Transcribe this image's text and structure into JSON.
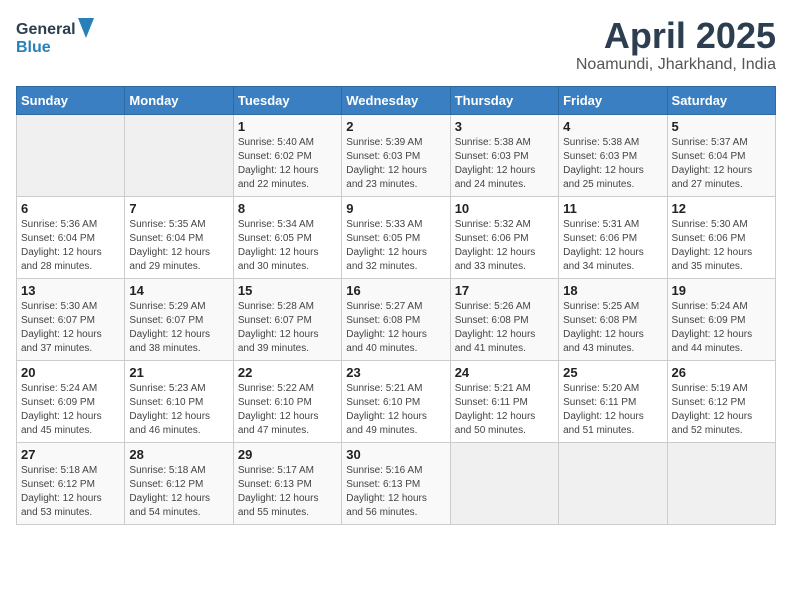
{
  "header": {
    "logo_line1": "General",
    "logo_line2": "Blue",
    "title": "April 2025",
    "subtitle": "Noamundi, Jharkhand, India"
  },
  "calendar": {
    "days_of_week": [
      "Sunday",
      "Monday",
      "Tuesday",
      "Wednesday",
      "Thursday",
      "Friday",
      "Saturday"
    ],
    "weeks": [
      [
        {
          "num": "",
          "detail": ""
        },
        {
          "num": "",
          "detail": ""
        },
        {
          "num": "1",
          "detail": "Sunrise: 5:40 AM\nSunset: 6:02 PM\nDaylight: 12 hours and 22 minutes."
        },
        {
          "num": "2",
          "detail": "Sunrise: 5:39 AM\nSunset: 6:03 PM\nDaylight: 12 hours and 23 minutes."
        },
        {
          "num": "3",
          "detail": "Sunrise: 5:38 AM\nSunset: 6:03 PM\nDaylight: 12 hours and 24 minutes."
        },
        {
          "num": "4",
          "detail": "Sunrise: 5:38 AM\nSunset: 6:03 PM\nDaylight: 12 hours and 25 minutes."
        },
        {
          "num": "5",
          "detail": "Sunrise: 5:37 AM\nSunset: 6:04 PM\nDaylight: 12 hours and 27 minutes."
        }
      ],
      [
        {
          "num": "6",
          "detail": "Sunrise: 5:36 AM\nSunset: 6:04 PM\nDaylight: 12 hours and 28 minutes."
        },
        {
          "num": "7",
          "detail": "Sunrise: 5:35 AM\nSunset: 6:04 PM\nDaylight: 12 hours and 29 minutes."
        },
        {
          "num": "8",
          "detail": "Sunrise: 5:34 AM\nSunset: 6:05 PM\nDaylight: 12 hours and 30 minutes."
        },
        {
          "num": "9",
          "detail": "Sunrise: 5:33 AM\nSunset: 6:05 PM\nDaylight: 12 hours and 32 minutes."
        },
        {
          "num": "10",
          "detail": "Sunrise: 5:32 AM\nSunset: 6:06 PM\nDaylight: 12 hours and 33 minutes."
        },
        {
          "num": "11",
          "detail": "Sunrise: 5:31 AM\nSunset: 6:06 PM\nDaylight: 12 hours and 34 minutes."
        },
        {
          "num": "12",
          "detail": "Sunrise: 5:30 AM\nSunset: 6:06 PM\nDaylight: 12 hours and 35 minutes."
        }
      ],
      [
        {
          "num": "13",
          "detail": "Sunrise: 5:30 AM\nSunset: 6:07 PM\nDaylight: 12 hours and 37 minutes."
        },
        {
          "num": "14",
          "detail": "Sunrise: 5:29 AM\nSunset: 6:07 PM\nDaylight: 12 hours and 38 minutes."
        },
        {
          "num": "15",
          "detail": "Sunrise: 5:28 AM\nSunset: 6:07 PM\nDaylight: 12 hours and 39 minutes."
        },
        {
          "num": "16",
          "detail": "Sunrise: 5:27 AM\nSunset: 6:08 PM\nDaylight: 12 hours and 40 minutes."
        },
        {
          "num": "17",
          "detail": "Sunrise: 5:26 AM\nSunset: 6:08 PM\nDaylight: 12 hours and 41 minutes."
        },
        {
          "num": "18",
          "detail": "Sunrise: 5:25 AM\nSunset: 6:08 PM\nDaylight: 12 hours and 43 minutes."
        },
        {
          "num": "19",
          "detail": "Sunrise: 5:24 AM\nSunset: 6:09 PM\nDaylight: 12 hours and 44 minutes."
        }
      ],
      [
        {
          "num": "20",
          "detail": "Sunrise: 5:24 AM\nSunset: 6:09 PM\nDaylight: 12 hours and 45 minutes."
        },
        {
          "num": "21",
          "detail": "Sunrise: 5:23 AM\nSunset: 6:10 PM\nDaylight: 12 hours and 46 minutes."
        },
        {
          "num": "22",
          "detail": "Sunrise: 5:22 AM\nSunset: 6:10 PM\nDaylight: 12 hours and 47 minutes."
        },
        {
          "num": "23",
          "detail": "Sunrise: 5:21 AM\nSunset: 6:10 PM\nDaylight: 12 hours and 49 minutes."
        },
        {
          "num": "24",
          "detail": "Sunrise: 5:21 AM\nSunset: 6:11 PM\nDaylight: 12 hours and 50 minutes."
        },
        {
          "num": "25",
          "detail": "Sunrise: 5:20 AM\nSunset: 6:11 PM\nDaylight: 12 hours and 51 minutes."
        },
        {
          "num": "26",
          "detail": "Sunrise: 5:19 AM\nSunset: 6:12 PM\nDaylight: 12 hours and 52 minutes."
        }
      ],
      [
        {
          "num": "27",
          "detail": "Sunrise: 5:18 AM\nSunset: 6:12 PM\nDaylight: 12 hours and 53 minutes."
        },
        {
          "num": "28",
          "detail": "Sunrise: 5:18 AM\nSunset: 6:12 PM\nDaylight: 12 hours and 54 minutes."
        },
        {
          "num": "29",
          "detail": "Sunrise: 5:17 AM\nSunset: 6:13 PM\nDaylight: 12 hours and 55 minutes."
        },
        {
          "num": "30",
          "detail": "Sunrise: 5:16 AM\nSunset: 6:13 PM\nDaylight: 12 hours and 56 minutes."
        },
        {
          "num": "",
          "detail": ""
        },
        {
          "num": "",
          "detail": ""
        },
        {
          "num": "",
          "detail": ""
        }
      ]
    ]
  }
}
